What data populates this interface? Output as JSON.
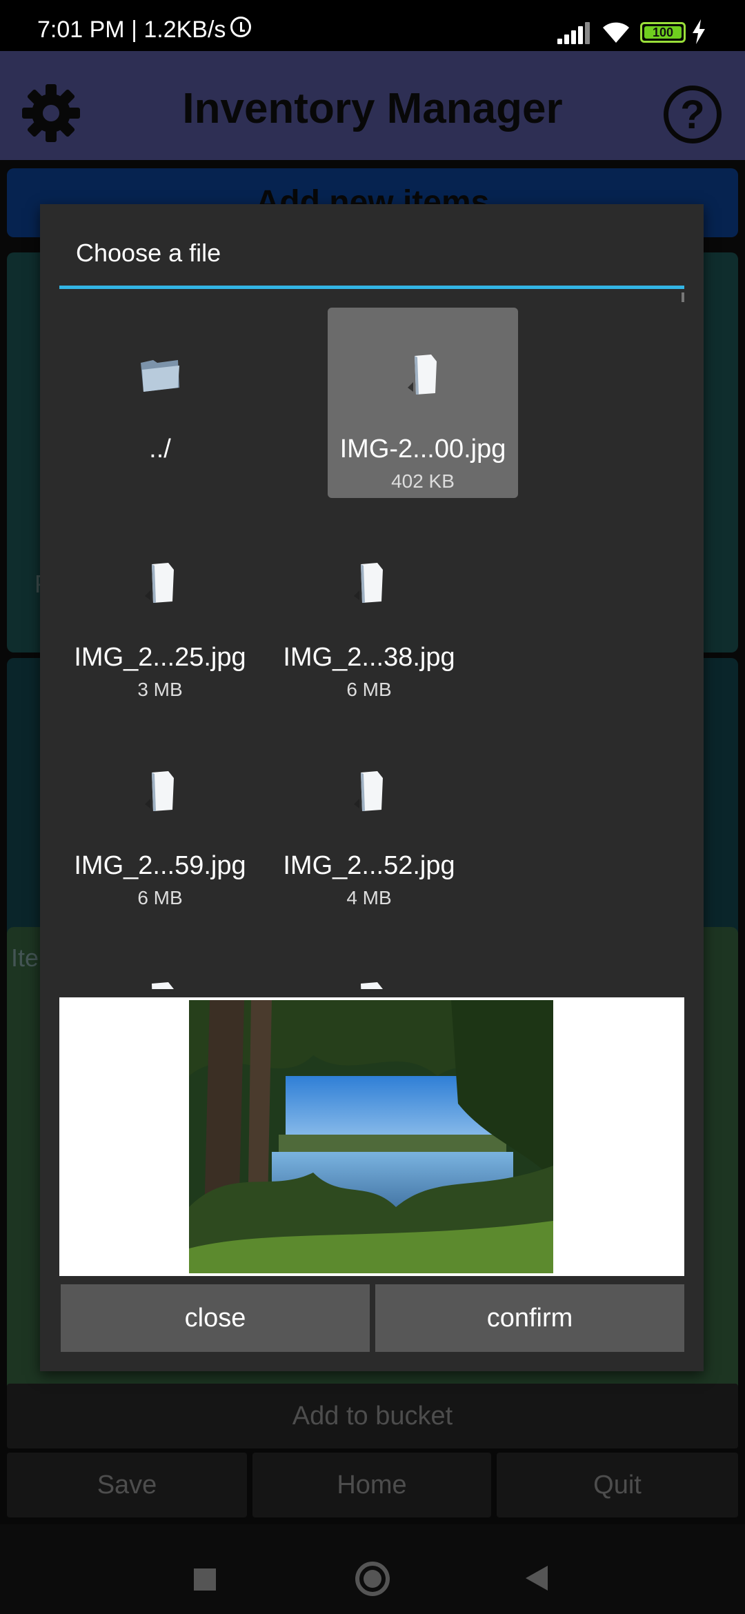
{
  "status_bar": {
    "time": "7:01 PM | 1.2KB/s",
    "battery": "100"
  },
  "app": {
    "title": "Inventory Manager",
    "add_items_label": "Add new items",
    "side_label_left_1": "P",
    "side_label_left_2": "Ite",
    "add_to_bucket": "Add to bucket",
    "save": "Save",
    "home": "Home",
    "quit": "Quit"
  },
  "dialog": {
    "title": "Choose a file",
    "files": [
      {
        "name": "../",
        "size": ""
      },
      {
        "name": "IMG-2...00.jpg",
        "size": "402 KB"
      },
      {
        "name": "IMG_2...25.jpg",
        "size": "3 MB"
      },
      {
        "name": "IMG_2...38.jpg",
        "size": "6 MB"
      },
      {
        "name": "IMG_2...59.jpg",
        "size": "6 MB"
      },
      {
        "name": "IMG_2...52.jpg",
        "size": "4 MB"
      }
    ],
    "close": "close",
    "confirm": "confirm"
  }
}
